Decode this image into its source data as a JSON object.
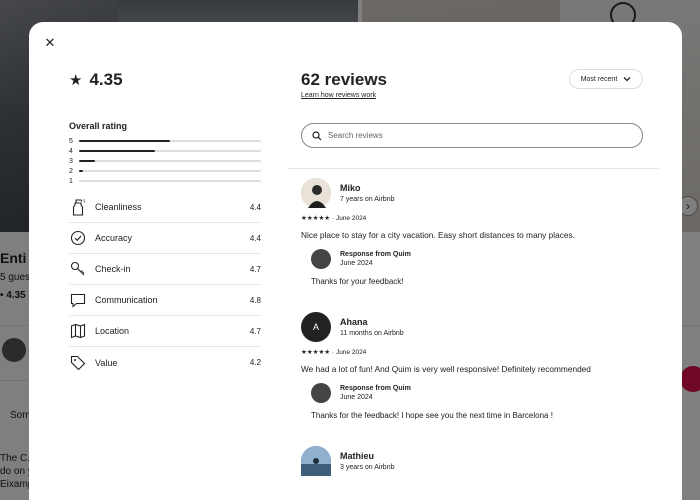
{
  "background": {
    "title": "Enti",
    "guests": "5 gues",
    "rating": "• 4.35",
    "section_label": "Som",
    "description": "The C... bathre... with children. The neighborhood is safe and family-friendly with plenty to do on your doorstep. The apartment is located next to Entença metro stop, right by Eixample"
  },
  "modal": {
    "overall": {
      "star": "★",
      "rating": "4.35",
      "label": "Overall rating",
      "distribution": [
        {
          "stars": "5",
          "fraction": 0.5
        },
        {
          "stars": "4",
          "fraction": 0.42
        },
        {
          "stars": "3",
          "fraction": 0.09
        },
        {
          "stars": "2",
          "fraction": 0.02
        },
        {
          "stars": "1",
          "fraction": 0.0
        }
      ]
    },
    "categories": [
      {
        "label": "Cleanliness",
        "score": "4.4",
        "icon": "spray-bottle-icon"
      },
      {
        "label": "Accuracy",
        "score": "4.4",
        "icon": "check-circle-icon"
      },
      {
        "label": "Check-in",
        "score": "4.7",
        "icon": "key-icon"
      },
      {
        "label": "Communication",
        "score": "4.8",
        "icon": "chat-bubble-icon"
      },
      {
        "label": "Location",
        "score": "4.7",
        "icon": "map-icon"
      },
      {
        "label": "Value",
        "score": "4.2",
        "icon": "tag-icon"
      }
    ],
    "reviews_title": "62 reviews",
    "learn_link": "Learn how reviews work",
    "sort_label": "Most recent",
    "search_placeholder": "Search reviews",
    "reviews": [
      {
        "name": "Miko",
        "subtitle": "7 years on Airbnb",
        "stars": "★★★★★",
        "date": "June 2024",
        "text": "Nice place to stay for a city vacation. Easy short distances to many places.",
        "response": {
          "from": "Response from Quim",
          "date": "June 2024",
          "text": "Thanks for your feedback!"
        }
      },
      {
        "name": "Ahana",
        "initial": "A",
        "subtitle": "11 months on Airbnb",
        "stars": "★★★★★",
        "date": "June 2024",
        "text": "We had a lot of fun! And Quim is very well responsive! Definitely recommended",
        "response": {
          "from": "Response from Quim",
          "date": "June 2024",
          "text": "Thanks for the feedback! I hope see you the next time in Barcelona !"
        }
      },
      {
        "name": "Mathieu",
        "subtitle": "3 years on Airbnb"
      }
    ]
  }
}
